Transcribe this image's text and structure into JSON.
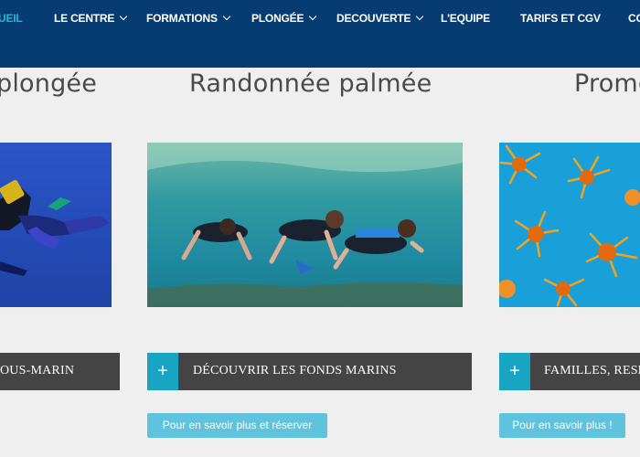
{
  "nav": {
    "items": [
      {
        "label": "UEIL",
        "active": true,
        "dropdown": false
      },
      {
        "label": "LE CENTRE",
        "dropdown": true
      },
      {
        "label": "FORMATIONS",
        "dropdown": true
      },
      {
        "label": "PLONGÉE",
        "dropdown": true
      },
      {
        "label": "DECOUVERTE",
        "dropdown": true
      },
      {
        "label": "L'EQUIPE",
        "dropdown": false
      },
      {
        "label": "TARIFS ET CGV",
        "dropdown": false
      },
      {
        "label": "CO",
        "dropdown": false
      }
    ],
    "background": "#073c73",
    "active_color": "#27b3d6"
  },
  "cards": [
    {
      "title": "plongée",
      "image": "scuba-diver-photo",
      "bar_label": "OUS-MARIN",
      "has_plus": false
    },
    {
      "title": "Randonnée palmée",
      "image": "snorkelers-photo",
      "bar_label": "DÉCOUVRIR LES FONDS MARINS",
      "has_plus": true,
      "plus": "+",
      "button": "Pour en savoir plus et réserver"
    },
    {
      "title": "Prome",
      "image": "orange-coral-photo",
      "bar_label": "FAMILLES, RESE",
      "has_plus": true,
      "plus": "+",
      "button": "Pour en savoir plus !"
    }
  ],
  "colors": {
    "bar": "#444444",
    "plus_box": "#17a5c3",
    "button": "#5fc3de",
    "page_bg": "#efefef"
  }
}
